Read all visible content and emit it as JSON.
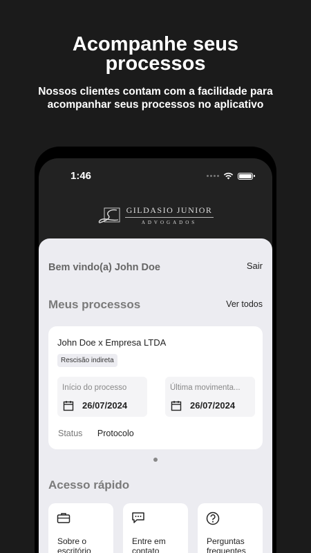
{
  "promo": {
    "headline": "Acompanhe seus processos",
    "subtitle": "Nossos clientes contam com a facilidade para acompanhar seus processos no aplicativo"
  },
  "status_bar": {
    "time": "1:46"
  },
  "logo": {
    "name": "GILDASIO JUNIOR",
    "sub": "ADVOGADOS"
  },
  "welcome": {
    "text": "Bem vindo(a) John Doe",
    "logout": "Sair"
  },
  "processes": {
    "title": "Meus processos",
    "see_all": "Ver todos",
    "card": {
      "title": "John Doe x Empresa LTDA",
      "tag": "Rescisão indireta",
      "start_label": "Início do processo",
      "start_date": "26/07/2024",
      "last_label": "Última movimenta...",
      "last_date": "26/07/2024",
      "status_label": "Status",
      "status_value": "Protocolo"
    }
  },
  "quick_access": {
    "title": "Acesso rápido",
    "items": [
      {
        "label": "Sobre o escritório",
        "icon": "briefcase-icon"
      },
      {
        "label": "Entre em contato",
        "icon": "chat-icon"
      },
      {
        "label": "Perguntas frequentes",
        "icon": "question-icon"
      }
    ]
  }
}
